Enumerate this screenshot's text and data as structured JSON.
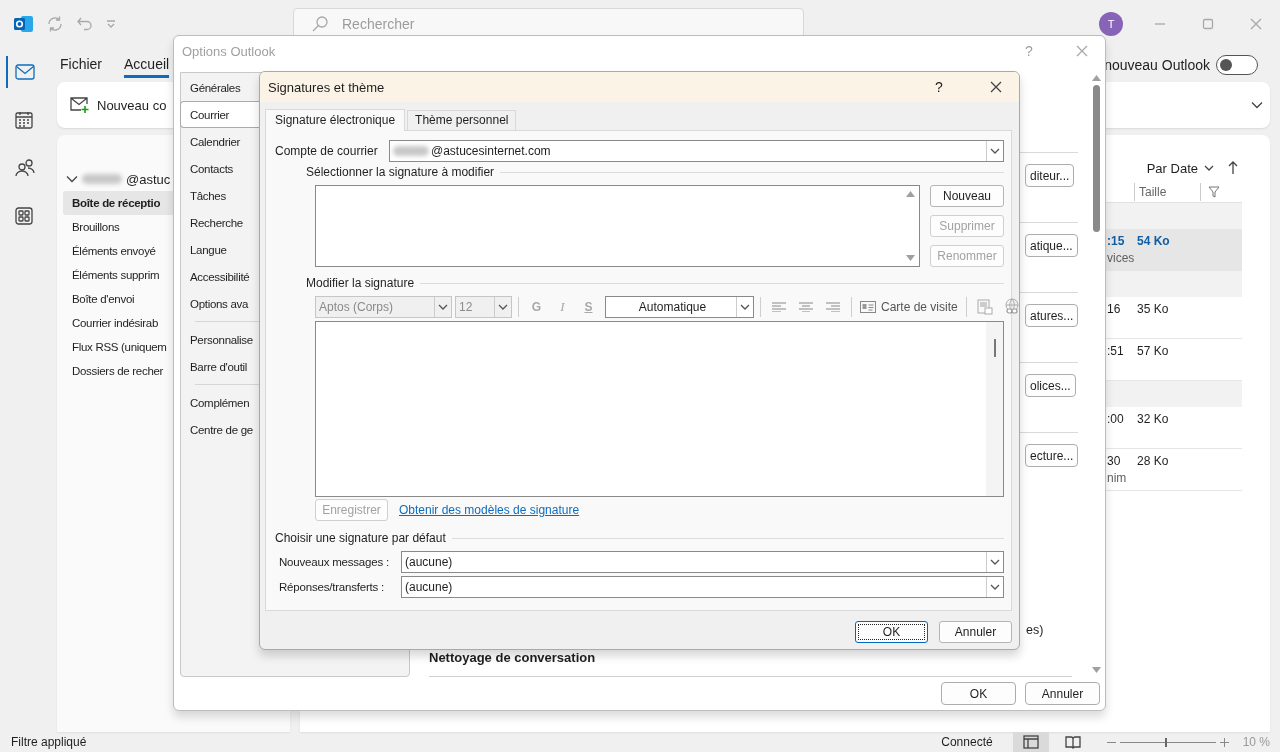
{
  "title_bar": {
    "search": {
      "placeholder": "Rechercher"
    },
    "avatar": "T"
  },
  "nav_rail": [
    {
      "kind": "mail",
      "selected": true
    },
    {
      "kind": "calendar",
      "selected": false
    },
    {
      "kind": "people",
      "selected": false
    },
    {
      "kind": "apps",
      "selected": false
    }
  ],
  "menu_tabs": [
    {
      "label": "Fichier",
      "selected": false
    },
    {
      "label": "Accueil",
      "selected": true
    }
  ],
  "new_outlook": {
    "label": "nouveau Outlook",
    "on": false
  },
  "ribbon": {
    "new_button": "Nouveau co"
  },
  "folders": {
    "account": "@astuc",
    "expanded": true,
    "items": [
      {
        "label": "Boîte de réceptio",
        "selected": true
      },
      {
        "label": "Brouillons",
        "selected": false
      },
      {
        "label": "Éléments envoyé",
        "selected": false
      },
      {
        "label": "Éléments supprim",
        "selected": false
      },
      {
        "label": "Boîte d'envoi",
        "selected": false
      },
      {
        "label": "Courrier indésirab",
        "selected": false
      },
      {
        "label": "Flux RSS (uniquem",
        "selected": false
      },
      {
        "label": "Dossiers de recher",
        "selected": false
      }
    ]
  },
  "message_list": {
    "sort": "Par Date",
    "columns": [
      "Taille"
    ],
    "rows": [
      {
        "kind": "group"
      },
      {
        "kind": "message",
        "time": ":15",
        "detail": "vices",
        "size": "54 Ko",
        "selected": true,
        "unread": true
      },
      {
        "kind": "group"
      },
      {
        "kind": "message",
        "time": "16",
        "size": "35 Ko",
        "selected": false,
        "unread": false
      },
      {
        "kind": "message",
        "time": ":51",
        "size": "57 Ko",
        "selected": false,
        "unread": false
      },
      {
        "kind": "group"
      },
      {
        "kind": "message",
        "time": ":00",
        "size": "32 Ko",
        "selected": false,
        "unread": false
      },
      {
        "kind": "message",
        "time": "30",
        "detail": "nim",
        "size": "28 Ko",
        "selected": false,
        "unread": false
      }
    ]
  },
  "options_dialog": {
    "title": "Options Outlook",
    "help": "?",
    "nav_groups": [
      [
        {
          "label": "Générales",
          "selected": false
        },
        {
          "label": "Courrier",
          "selected": true
        },
        {
          "label": "Calendrier",
          "selected": false
        },
        {
          "label": "Contacts",
          "selected": false
        },
        {
          "label": "Tâches",
          "selected": false
        },
        {
          "label": "Recherche",
          "selected": false
        },
        {
          "label": "Langue",
          "selected": false
        },
        {
          "label": "Accessibilité",
          "selected": false
        },
        {
          "label": "Options ava",
          "selected": false
        }
      ],
      [
        {
          "label": "Personnalise",
          "selected": false
        },
        {
          "label": "Barre d'outil",
          "selected": false
        }
      ],
      [
        {
          "label": "Complémen",
          "selected": false
        },
        {
          "label": "Centre de ge",
          "selected": false
        }
      ]
    ],
    "section_buttons": [
      "diteur...",
      "atique...",
      "atures...",
      "olices...",
      "ecture..."
    ],
    "fragment": "es)",
    "section_title": "Nettoyage de conversation",
    "buttons": [
      "OK",
      "Annuler"
    ]
  },
  "signatures_dialog": {
    "title": "Signatures et thème",
    "help": "?",
    "tabs": [
      {
        "label": "Signature électronique",
        "selected": true
      },
      {
        "label": "Thème personnel",
        "selected": false
      }
    ],
    "account": {
      "label": "Compte de courrier",
      "value": "@astucesinternet.com"
    },
    "select_section": "Sélectionner la signature à modifier",
    "list_buttons": [
      {
        "label": "Nouveau",
        "disabled": false
      },
      {
        "label": "Supprimer",
        "disabled": true
      },
      {
        "label": "Renommer",
        "disabled": true
      }
    ],
    "edit_section": "Modifier la signature",
    "toolbar": {
      "font": {
        "value": "Aptos (Corps)",
        "disabled": true
      },
      "size": {
        "value": "12",
        "disabled": true
      },
      "format": [
        {
          "label": "G",
          "kind": "bold",
          "disabled": true
        },
        {
          "label": "I",
          "kind": "italic",
          "disabled": true
        },
        {
          "label": "S",
          "kind": "underline",
          "disabled": true
        }
      ],
      "color_picker": "Automatique",
      "business_card": "Carte de visite"
    },
    "save_button": {
      "label": "Enregistrer",
      "disabled": true
    },
    "templates_link": "Obtenir des modèles de signature",
    "defaults_section": "Choisir une signature par défaut",
    "defaults": [
      {
        "label": "Nouveaux messages :",
        "value": "(aucune)"
      },
      {
        "label": "Réponses/transferts :",
        "value": "(aucune)"
      }
    ],
    "buttons": [
      {
        "label": "OK",
        "focused": true
      },
      {
        "label": "Annuler",
        "focused": false
      }
    ]
  },
  "status_bar": {
    "filter": "Filtre appliqué",
    "connection": "Connecté",
    "views": [
      {
        "kind": "normal",
        "selected": true
      },
      {
        "kind": "reading",
        "selected": false
      }
    ],
    "zoom": {
      "level": 0.47,
      "reading": "10 %"
    }
  }
}
